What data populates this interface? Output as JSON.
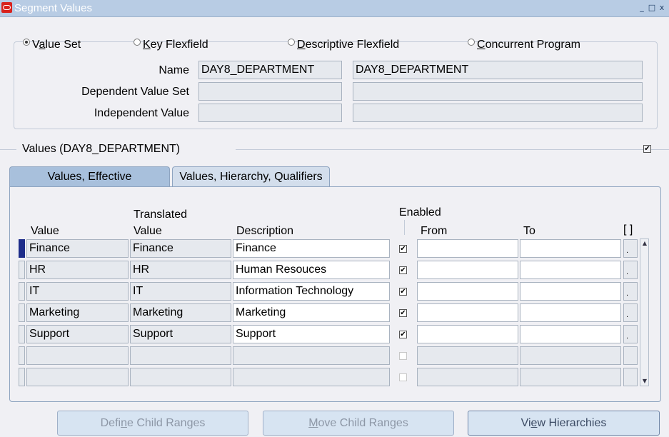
{
  "window": {
    "title": "Segment Values",
    "controls": [
      "_",
      "□",
      "x"
    ]
  },
  "radios": [
    {
      "prefix": "V",
      "underline": "a",
      "rest": "lue Set",
      "selected": true
    },
    {
      "prefix": "",
      "underline": "K",
      "rest": "ey Flexfield",
      "selected": false
    },
    {
      "prefix": "",
      "underline": "D",
      "rest": "escriptive Flexfield",
      "selected": false
    },
    {
      "prefix": "",
      "underline": "C",
      "rest": "oncurrent Program",
      "selected": false
    }
  ],
  "form": {
    "name_label": "Name",
    "name_value": "DAY8_DEPARTMENT",
    "name_desc": "DAY8_DEPARTMENT",
    "dependent_label": "Dependent Value Set",
    "dependent_value": "",
    "dependent_desc": "",
    "independent_label": "Independent Value",
    "independent_value": "",
    "independent_desc": ""
  },
  "section": {
    "title": "Values (DAY8_DEPARTMENT)",
    "checked": true
  },
  "tabs": [
    {
      "label": "Values, Effective",
      "active": true
    },
    {
      "label": "Values, Hierarchy, Qualifiers",
      "active": false
    }
  ],
  "table": {
    "headers": {
      "value": "Value",
      "translated_top": "Translated",
      "translated_bottom": "Value",
      "description": "Description",
      "enabled": "Enabled",
      "from": "From",
      "to": "To",
      "extra": "[ ]"
    },
    "rows": [
      {
        "value": "Finance",
        "translated": "Finance",
        "description": "Finance",
        "enabled": true,
        "from": "",
        "to": "",
        "current": true
      },
      {
        "value": "HR",
        "translated": "HR",
        "description": "Human Resouces",
        "enabled": true,
        "from": "",
        "to": "",
        "current": false
      },
      {
        "value": "IT",
        "translated": "IT",
        "description": "Information Technology",
        "enabled": true,
        "from": "",
        "to": "",
        "current": false
      },
      {
        "value": "Marketing",
        "translated": "Marketing",
        "description": "Marketing",
        "enabled": true,
        "from": "",
        "to": "",
        "current": false
      },
      {
        "value": "Support",
        "translated": "Support",
        "description": "Support",
        "enabled": true,
        "from": "",
        "to": "",
        "current": false
      },
      {
        "value": "",
        "translated": "",
        "description": "",
        "enabled": false,
        "from": "",
        "to": "",
        "current": false,
        "empty": true
      },
      {
        "value": "",
        "translated": "",
        "description": "",
        "enabled": false,
        "from": "",
        "to": "",
        "current": false,
        "empty": true
      }
    ]
  },
  "buttons": [
    {
      "prefix": "Defi",
      "underline": "n",
      "rest": "e Child Ranges",
      "enabled": false
    },
    {
      "prefix": "",
      "underline": "M",
      "rest": "ove Child Ranges",
      "enabled": false
    },
    {
      "prefix": "Vi",
      "underline": "e",
      "rest": "w Hierarchies",
      "enabled": true
    }
  ],
  "icons": {
    "app": "oracle-app-icon",
    "check": "✔",
    "dot": "."
  }
}
